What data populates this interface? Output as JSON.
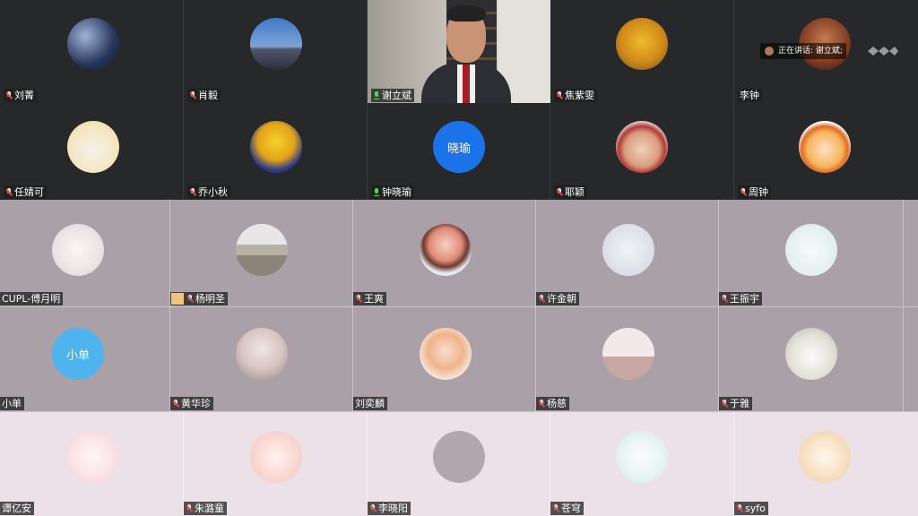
{
  "row1": [
    {
      "name": "刘菁",
      "mic": "off"
    },
    {
      "name": "肖毅",
      "mic": "off"
    },
    {
      "name": "谢立斌",
      "mic": "on"
    },
    {
      "name": "焦紫雯",
      "mic": "off"
    },
    {
      "name": "李钟",
      "mic": "none"
    }
  ],
  "row2": [
    {
      "name": "任婧可",
      "mic": "off"
    },
    {
      "name": "乔小秋",
      "mic": "off"
    },
    {
      "name": "钟晓瑜",
      "mic": "on",
      "avatar_text": "晓瑜"
    },
    {
      "name": "耶颖",
      "mic": "off"
    },
    {
      "name": "周钟",
      "mic": "off"
    }
  ],
  "row3": [
    {
      "name": "CUPL-傅月明",
      "mic": "none"
    },
    {
      "name": "杨明圣",
      "mic": "off"
    },
    {
      "name": "王爽",
      "mic": "off"
    },
    {
      "name": "许金朝",
      "mic": "off"
    },
    {
      "name": "王振宇",
      "mic": "off"
    }
  ],
  "row4": [
    {
      "name": "小单",
      "mic": "none",
      "avatar_text": "小单"
    },
    {
      "name": "黄华珍",
      "mic": "off"
    },
    {
      "name": "刘奕麟",
      "mic": "none"
    },
    {
      "name": "杨慈",
      "mic": "off"
    },
    {
      "name": "于雅",
      "mic": "off"
    }
  ],
  "row5": [
    {
      "name": "谭亿安",
      "mic": "none"
    },
    {
      "name": "朱潞童",
      "mic": "off"
    },
    {
      "name": "李晓阳",
      "mic": "off"
    },
    {
      "name": "苍穹",
      "mic": "off"
    },
    {
      "name": "syfo",
      "mic": "off"
    }
  ],
  "speaking_indicator": "正在讲话: 谢立斌;",
  "colors": {
    "avatar_blue": "#1a73e8",
    "avatar_lightblue": "#4fb3ee",
    "active_mic": "#4cd964"
  }
}
